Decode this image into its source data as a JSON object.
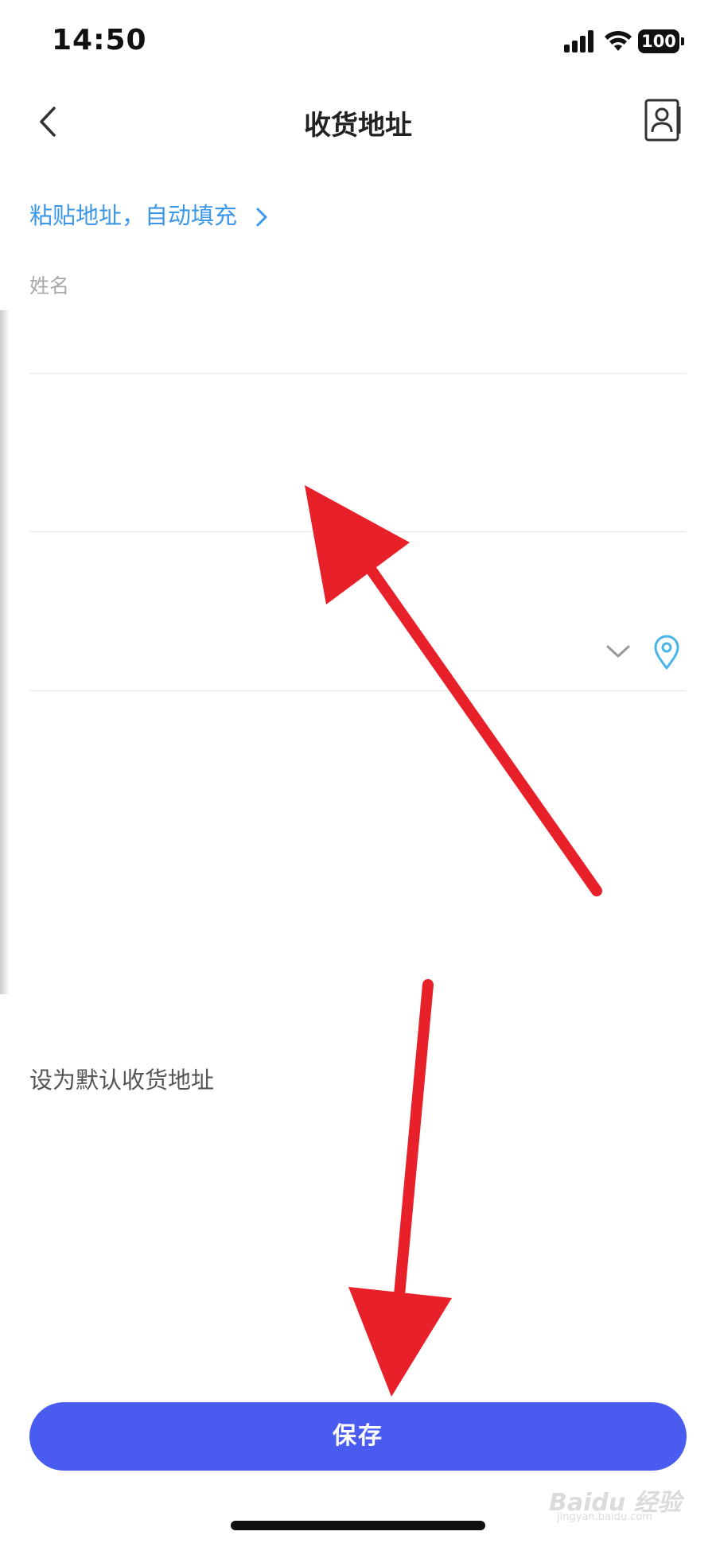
{
  "status_bar": {
    "time": "14:50",
    "battery": "100",
    "icons": [
      "signal-icon",
      "wifi-icon",
      "battery-icon"
    ]
  },
  "header": {
    "title": "收货地址",
    "back_icon": "chevron-left-icon",
    "contacts_icon": "contact-book-icon"
  },
  "paste_link": {
    "label": "粘贴地址，自动填充",
    "icon": "chevron-right-icon",
    "color": "#3b97e8"
  },
  "form": {
    "name_label": "姓名",
    "name_value": "",
    "phone_label": "",
    "phone_value": "",
    "region_label": "",
    "region_value": "",
    "detail_label": "",
    "detail_value": "",
    "tag_label": ""
  },
  "default_address": {
    "label": "设为默认收货地址",
    "enabled": false
  },
  "save_button": {
    "label": "保存",
    "color": "#4a5cf0"
  },
  "watermark": {
    "text": "Baidu 经验",
    "sub": "jingyan.baidu.com"
  },
  "annotation_color": "#e8202a"
}
